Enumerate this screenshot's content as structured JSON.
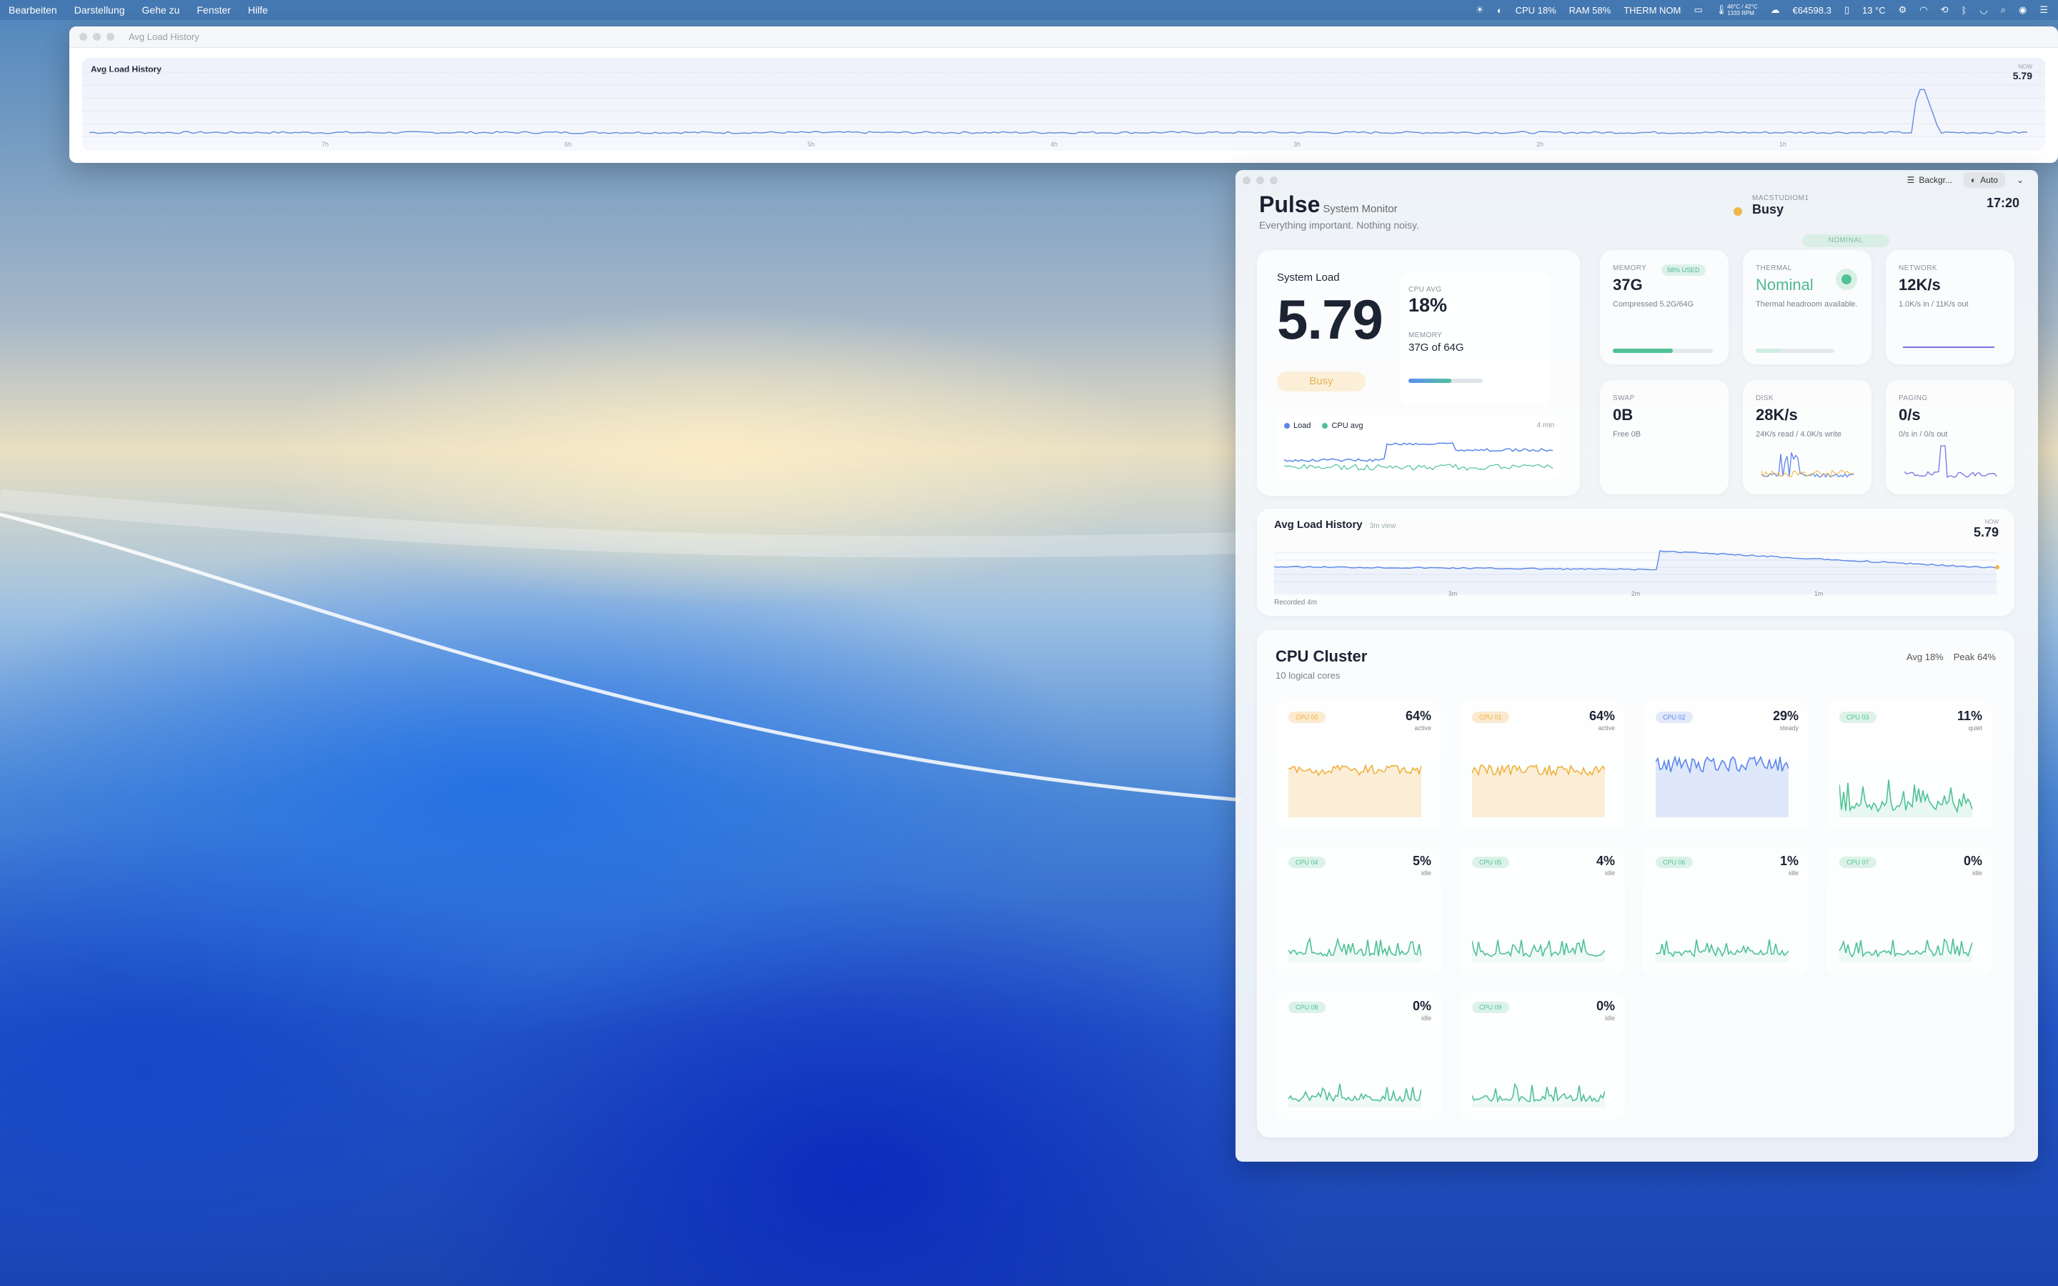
{
  "menubar": {
    "items": [
      "Bearbeiten",
      "Darstellung",
      "Gehe zu",
      "Fenster",
      "Hilfe"
    ],
    "status": {
      "cpu": "CPU 18%",
      "ram": "RAM 58%",
      "therm": "THERM NOM",
      "temp": "46°C / 42°C",
      "rpm": "1333 RPM",
      "price": "€64598.3",
      "weather": "13 °C"
    }
  },
  "history_window": {
    "title": "Avg Load History",
    "label": "Avg Load History",
    "now_label": "NOW",
    "now_value": "5.79",
    "ticks": [
      "7h",
      "6h",
      "5h",
      "4h",
      "3h",
      "2h",
      "1h"
    ]
  },
  "app": {
    "toolbar": {
      "background": "Backgr...",
      "appearance": "Auto"
    },
    "brand": "Pulse",
    "subtitle": "System Monitor",
    "tagline": "Everything important. Nothing noisy.",
    "host": "MACSTUDIOM1",
    "status": "Busy",
    "thermal_badge": "NOMINAL",
    "time": "17:20",
    "system_load": {
      "title": "System Load",
      "value": "5.79",
      "state": "Busy",
      "cpu_avg_label": "CPU AVG",
      "cpu_avg": "18%",
      "memory_label": "MEMORY",
      "memory": "37G of 64G",
      "legend": [
        "Load",
        "CPU avg"
      ],
      "window": "4 min"
    },
    "memory": {
      "label": "MEMORY",
      "value": "37G",
      "badge": "58% USED",
      "sub": "Compressed 5.2G/64G",
      "fraction": 0.58
    },
    "thermal": {
      "label": "THERMAL",
      "value": "Nominal",
      "sub": "Thermal headroom available."
    },
    "network": {
      "label": "NETWORK",
      "value": "12K/s",
      "sub": "1.0K/s in / 11K/s out"
    },
    "swap": {
      "label": "SWAP",
      "value": "0B",
      "sub": "Free 0B"
    },
    "disk": {
      "label": "DISK",
      "value": "28K/s",
      "sub": "24K/s read / 4.0K/s write"
    },
    "paging": {
      "label": "PAGING",
      "value": "0/s",
      "sub": "0/s in / 0/s out"
    },
    "history": {
      "title": "Avg Load History",
      "range": "3m view",
      "now_label": "NOW",
      "now_value": "5.79",
      "recorded": "Recorded 4m",
      "ticks": [
        "3m",
        "2m",
        "1m"
      ]
    },
    "cluster": {
      "title": "CPU Cluster",
      "subtitle": "10 logical cores",
      "avg": "Avg 18%",
      "peak": "Peak 64%",
      "cores": [
        {
          "name": "CPU 00",
          "pct": "64%",
          "state": "active",
          "level": 0.64
        },
        {
          "name": "CPU 01",
          "pct": "64%",
          "state": "active",
          "level": 0.64
        },
        {
          "name": "CPU 02",
          "pct": "29%",
          "state": "steady",
          "level": 0.29
        },
        {
          "name": "CPU 03",
          "pct": "11%",
          "state": "quiet",
          "level": 0.11
        },
        {
          "name": "CPU 04",
          "pct": "5%",
          "state": "idle",
          "level": 0.05
        },
        {
          "name": "CPU 05",
          "pct": "4%",
          "state": "idle",
          "level": 0.04
        },
        {
          "name": "CPU 06",
          "pct": "1%",
          "state": "idle",
          "level": 0.01
        },
        {
          "name": "CPU 07",
          "pct": "0%",
          "state": "idle",
          "level": 0
        },
        {
          "name": "CPU 08",
          "pct": "0%",
          "state": "idle",
          "level": 0
        },
        {
          "name": "CPU 09",
          "pct": "0%",
          "state": "idle",
          "level": 0
        }
      ]
    }
  },
  "colors": {
    "active": "#f0b13c",
    "steady": "#5b86ea",
    "quiet": "#4fc296",
    "accent_green": "#4fc296",
    "accent_orange": "#f0b64a"
  }
}
